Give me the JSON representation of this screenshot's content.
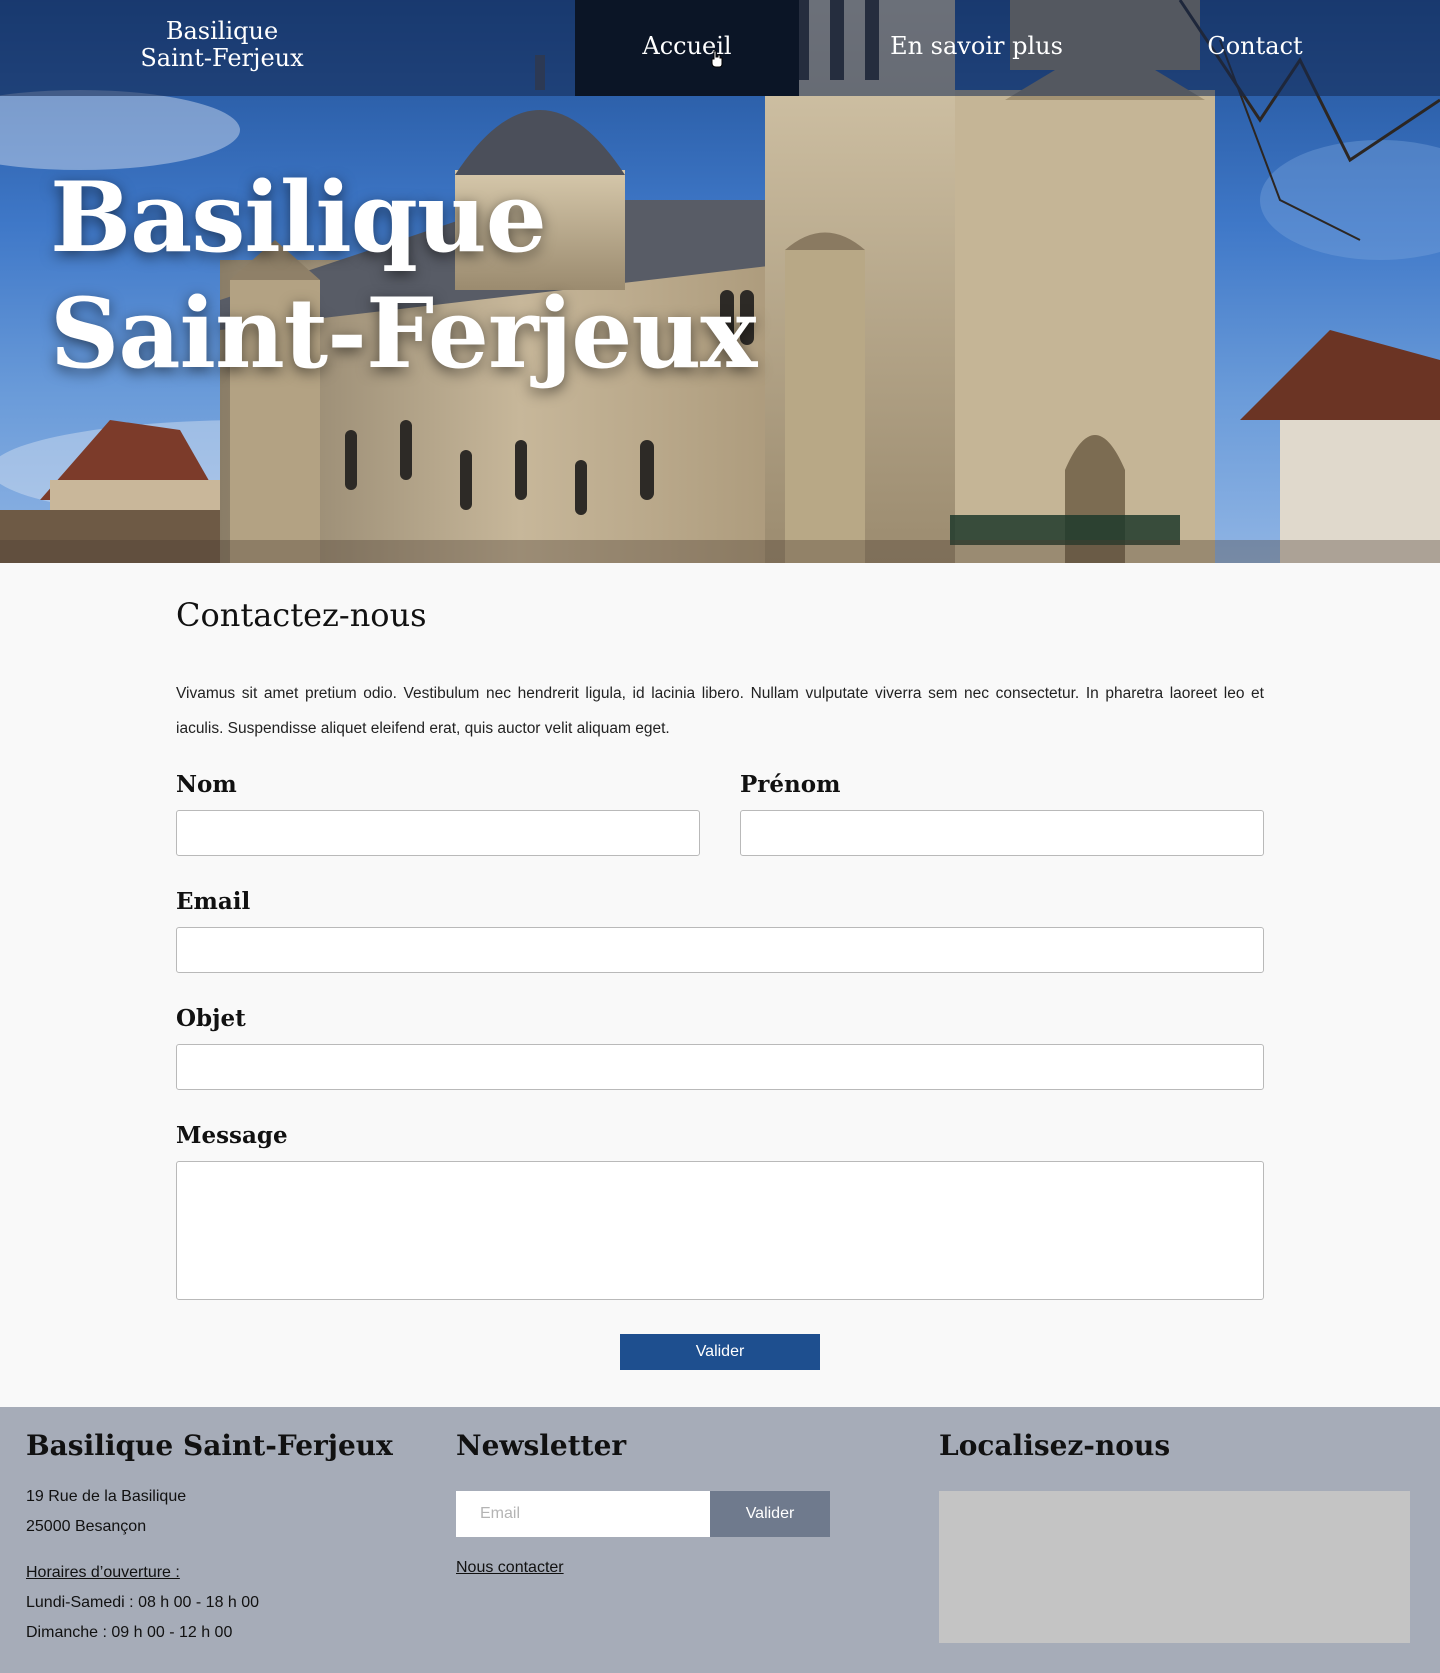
{
  "nav": {
    "brand_line1": "Basilique",
    "brand_line2": "Saint-Ferjeux",
    "items": [
      {
        "label": "Accueil",
        "active": true
      },
      {
        "label": "En savoir plus",
        "active": false
      },
      {
        "label": "Contact",
        "active": false
      }
    ]
  },
  "hero": {
    "title_line1": "Basilique",
    "title_line2": "Saint-Ferjeux"
  },
  "contact": {
    "heading": "Contactez-nous",
    "intro": "Vivamus sit amet pretium odio. Vestibulum nec hendrerit ligula, id lacinia libero. Nullam vulputate viverra sem nec consectetur. In pharetra laoreet leo et iaculis. Suspendisse aliquet eleifend erat, quis auctor velit aliquam eget.",
    "fields": {
      "nom": {
        "label": "Nom",
        "value": ""
      },
      "prenom": {
        "label": "Prénom",
        "value": ""
      },
      "email": {
        "label": "Email",
        "value": ""
      },
      "objet": {
        "label": "Objet",
        "value": ""
      },
      "message": {
        "label": "Message",
        "value": ""
      }
    },
    "submit_label": "Valider"
  },
  "footer": {
    "about": {
      "heading": "Basilique Saint-Ferjeux",
      "address1": "19 Rue de la Basilique",
      "address2": "25000 Besançon",
      "hours_title": "Horaires d’ouverture :",
      "hours_week": "Lundi-Samedi : 08 h 00 - 18 h 00",
      "hours_sunday": "Dimanche : 09 h 00 - 12 h 00"
    },
    "newsletter": {
      "heading": "Newsletter",
      "email_placeholder": "Email",
      "button_label": "Valider",
      "contact_link": "Nous contacter"
    },
    "locate": {
      "heading": "Localisez-nous"
    }
  },
  "colors": {
    "nav_bg": "#14284f",
    "nav_active": "#0b1526",
    "submit_bg": "#1e4f8f",
    "footer_bg": "#a6acb8",
    "newsletter_btn": "#6f7a8d",
    "map_placeholder": "#c4c4c4"
  }
}
